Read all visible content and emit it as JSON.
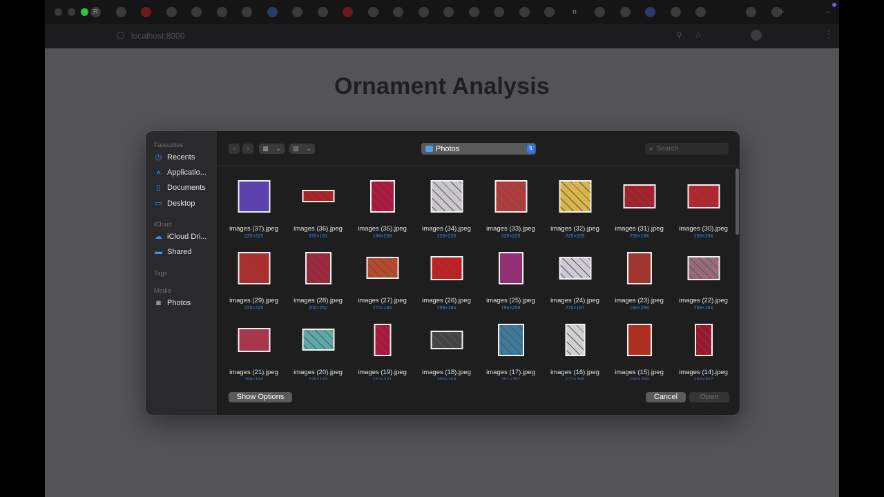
{
  "browser": {
    "url": "localhost:8000",
    "tab_icons": [
      "R",
      "",
      "",
      "",
      "",
      "",
      "",
      "",
      "",
      "",
      "",
      "",
      "",
      "",
      "",
      "",
      "",
      "",
      "",
      "n",
      "",
      "",
      "",
      "",
      "",
      "",
      "",
      ""
    ]
  },
  "page": {
    "title": "Ornament Analysis"
  },
  "dialog": {
    "sidebar": {
      "favourites_header": "Favourites",
      "favourites": [
        {
          "label": "Recents",
          "icon": "clock-icon"
        },
        {
          "label": "Applicatio...",
          "icon": "applications-icon"
        },
        {
          "label": "Documents",
          "icon": "document-icon"
        },
        {
          "label": "Desktop",
          "icon": "desktop-icon"
        }
      ],
      "icloud_header": "iCloud",
      "icloud": [
        {
          "label": "iCloud Dri...",
          "icon": "cloud-icon"
        },
        {
          "label": "Shared",
          "icon": "shared-folder-icon"
        }
      ],
      "tags_header": "Tags",
      "media_header": "Media",
      "media": [
        {
          "label": "Photos",
          "icon": "camera-icon"
        }
      ]
    },
    "location": "Photos",
    "search_placeholder": "Search",
    "files": [
      {
        "name": "images (37).jpeg",
        "dims": "225×225"
      },
      {
        "name": "images (36).jpeg",
        "dims": "370×131"
      },
      {
        "name": "images (35).jpeg",
        "dims": "194×259"
      },
      {
        "name": "images (34).jpeg",
        "dims": "225×225"
      },
      {
        "name": "images (33).jpeg",
        "dims": "225×225"
      },
      {
        "name": "images (32).jpeg",
        "dims": "225×225"
      },
      {
        "name": "images (31).jpeg",
        "dims": "259×194"
      },
      {
        "name": "images (30).jpeg",
        "dims": "259×194"
      },
      {
        "name": "images (29).jpeg",
        "dims": "225×225"
      },
      {
        "name": "images (28).jpeg",
        "dims": "200×252"
      },
      {
        "name": "images (27).jpeg",
        "dims": "274×184"
      },
      {
        "name": "images (26).jpeg",
        "dims": "259×194"
      },
      {
        "name": "images (25).jpeg",
        "dims": "194×259"
      },
      {
        "name": "images (24).jpeg",
        "dims": "270×187"
      },
      {
        "name": "images (23).jpeg",
        "dims": "194×259"
      },
      {
        "name": "images (22).jpeg",
        "dims": "259×194"
      },
      {
        "name": "images (21).jpeg",
        "dims": "259×194"
      },
      {
        "name": "images (20).jpeg",
        "dims": "276×183"
      },
      {
        "name": "images (19).jpeg",
        "dims": "152×331"
      },
      {
        "name": "images (18).jpeg",
        "dims": "300×168"
      },
      {
        "name": "images (17).jpeg",
        "dims": "201×251"
      },
      {
        "name": "images (16).jpeg",
        "dims": "177×285"
      },
      {
        "name": "images (15).jpeg",
        "dims": "194×259"
      },
      {
        "name": "images (14).jpeg",
        "dims": "164×307"
      }
    ],
    "buttons": {
      "show_options": "Show Options",
      "cancel": "Cancel",
      "open": "Open"
    }
  }
}
